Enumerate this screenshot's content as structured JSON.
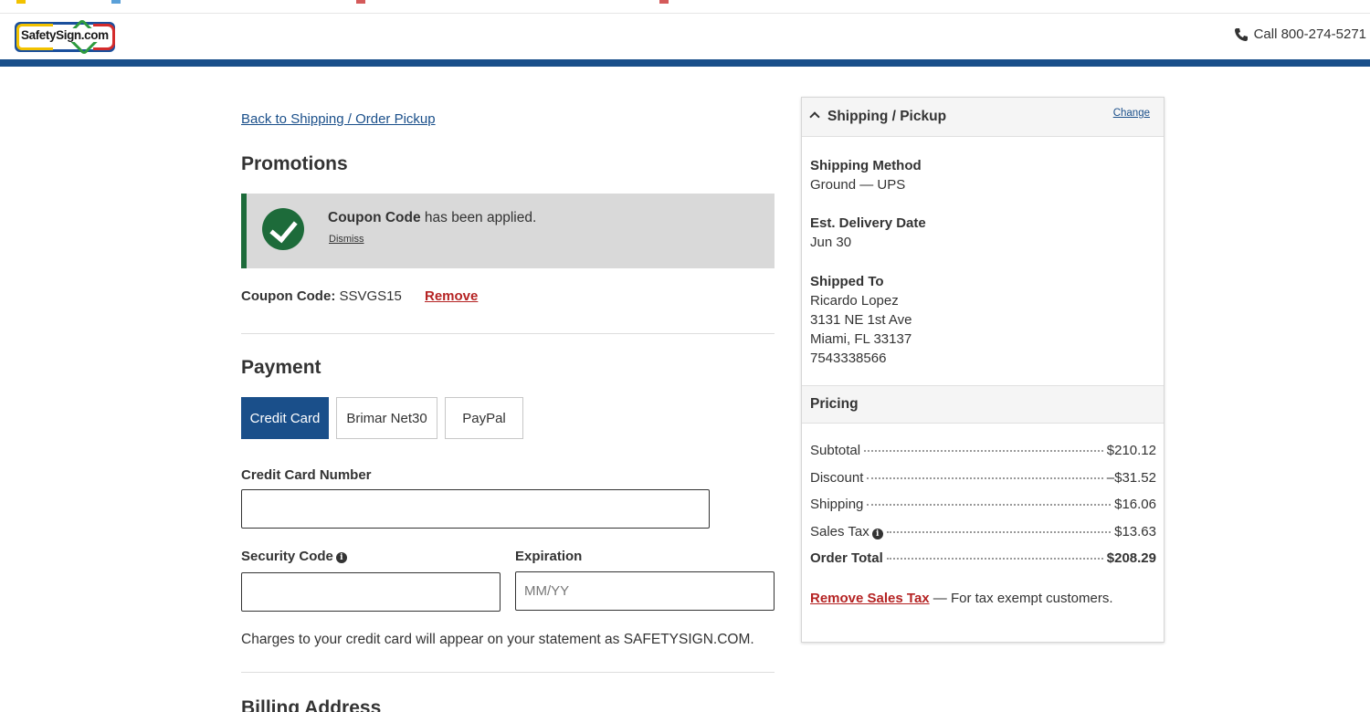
{
  "header": {
    "logo_text": "SafetySign.com",
    "phone_label": "Call 800-274-5271"
  },
  "checkout": {
    "back_link": "Back to Shipping / Order Pickup",
    "promotions": {
      "title": "Promotions",
      "alert_bold": "Coupon Code",
      "alert_rest": " has been applied.",
      "dismiss": "Dismiss",
      "coupon_label": "Coupon Code:",
      "coupon_value": " SSVGS15",
      "remove": "Remove"
    },
    "payment": {
      "title": "Payment",
      "methods": [
        "Credit Card",
        "Brimar Net30",
        "PayPal"
      ],
      "selected": "Credit Card",
      "card_number_label": "Credit Card Number",
      "card_number_value": "",
      "security_label": "Security Code",
      "security_value": "",
      "expiration_label": "Expiration",
      "expiration_placeholder": "MM/YY",
      "statement": "Charges to your credit card will appear on your statement as SAFETYSIGN.COM."
    },
    "billing_title": "Billing Address"
  },
  "sidebar": {
    "title": "Shipping / Pickup",
    "change": "Change",
    "shipping_method_label": "Shipping Method",
    "shipping_method_value": "Ground — UPS",
    "delivery_label": "Est. Delivery Date",
    "delivery_value": "Jun 30",
    "shipped_to_label": "Shipped To",
    "address": [
      "Ricardo Lopez",
      "3131 NE 1st Ave",
      "Miami, FL 33137",
      "7543338566"
    ],
    "pricing_title": "Pricing",
    "pricing": [
      {
        "label": "Subtotal",
        "value": "$210.12"
      },
      {
        "label": "Discount",
        "value": "–$31.52"
      },
      {
        "label": "Shipping",
        "value": "$16.06"
      },
      {
        "label": "Sales Tax",
        "value": "$13.63"
      },
      {
        "label": "Order Total",
        "value": "$208.29"
      }
    ],
    "remove_tax_link": "Remove Sales Tax",
    "remove_tax_rest": " — For tax exempt customers."
  },
  "colors": {
    "brand_blue": "#1a4f8a",
    "success_green": "#1d6b3a",
    "link_red": "#b52323"
  }
}
